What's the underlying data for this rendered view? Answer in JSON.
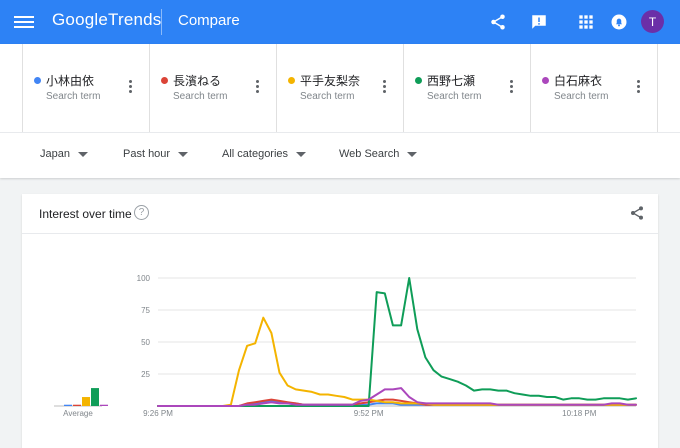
{
  "header": {
    "logo_google": "Google",
    "logo_trends": "Trends",
    "page_title": "Compare",
    "avatar_letter": "T",
    "icons": [
      "menu-icon",
      "share-icon",
      "feedback-icon",
      "apps-icon",
      "notifications-icon"
    ]
  },
  "terms": [
    {
      "name": "小林由依",
      "sub": "Search term",
      "color": "#4285f4"
    },
    {
      "name": "長濱ねる",
      "sub": "Search term",
      "color": "#db4437"
    },
    {
      "name": "平手友梨奈",
      "sub": "Search term",
      "color": "#f4b400"
    },
    {
      "name": "西野七瀬",
      "sub": "Search term",
      "color": "#0f9d58"
    },
    {
      "name": "白石麻衣",
      "sub": "Search term",
      "color": "#ab47bc"
    }
  ],
  "filters": {
    "region": "Japan",
    "time": "Past hour",
    "category": "All categories",
    "property": "Web Search"
  },
  "chart_card": {
    "title": "Interest over time",
    "help": "?"
  },
  "chart_data": {
    "type": "line",
    "y_ticks": [
      "100",
      "75",
      "50",
      "25"
    ],
    "ylim": [
      0,
      100
    ],
    "x_ticks": [
      {
        "label": "9:26 PM",
        "minute": 0
      },
      {
        "label": "9:52 PM",
        "minute": 26
      },
      {
        "label": "10:18 PM",
        "minute": 52
      }
    ],
    "xlim": [
      0,
      59
    ],
    "average_label": "Average",
    "average": [
      1,
      1,
      7,
      14,
      1
    ],
    "grid": true,
    "series": [
      {
        "name": "小林由依",
        "color": "#4285f4",
        "values": [
          0,
          0,
          0,
          0,
          0,
          0,
          0,
          0,
          0,
          0,
          0,
          1,
          2,
          3,
          4,
          3,
          2,
          2,
          1,
          1,
          1,
          1,
          1,
          1,
          1,
          1,
          1,
          2,
          2,
          2,
          1,
          1,
          1,
          1,
          1,
          1,
          1,
          1,
          1,
          1,
          1,
          1,
          1,
          1,
          1,
          1,
          1,
          1,
          1,
          1,
          1,
          1,
          1,
          1,
          1,
          1,
          1,
          1,
          1,
          1
        ]
      },
      {
        "name": "長濱ねる",
        "color": "#db4437",
        "values": [
          0,
          0,
          0,
          0,
          0,
          0,
          0,
          0,
          0,
          0,
          0,
          2,
          3,
          4,
          5,
          4,
          3,
          2,
          1,
          1,
          1,
          1,
          1,
          1,
          1,
          2,
          3,
          4,
          5,
          5,
          4,
          3,
          2,
          1,
          1,
          1,
          1,
          1,
          1,
          1,
          1,
          1,
          1,
          1,
          1,
          1,
          1,
          1,
          1,
          1,
          1,
          1,
          1,
          1,
          1,
          1,
          1,
          1,
          1,
          1
        ]
      },
      {
        "name": "平手友梨奈",
        "color": "#f4b400",
        "values": [
          0,
          0,
          0,
          0,
          0,
          0,
          0,
          0,
          0,
          1,
          28,
          47,
          49,
          69,
          57,
          26,
          16,
          13,
          12,
          11,
          9,
          9,
          8,
          7,
          5,
          5,
          5,
          4,
          3,
          3,
          2,
          2,
          2,
          2,
          1,
          1,
          1,
          1,
          1,
          1,
          1,
          1,
          1,
          1,
          1,
          1,
          1,
          1,
          1,
          1,
          1,
          1,
          1,
          1,
          1,
          1,
          1,
          1,
          1,
          1
        ]
      },
      {
        "name": "西野七瀬",
        "color": "#0f9d58",
        "values": [
          0,
          0,
          0,
          0,
          0,
          0,
          0,
          0,
          0,
          0,
          0,
          0,
          0,
          0,
          0,
          0,
          0,
          0,
          0,
          0,
          0,
          0,
          0,
          0,
          0,
          0,
          0,
          89,
          88,
          63,
          63,
          100,
          60,
          38,
          28,
          23,
          21,
          19,
          16,
          12,
          13,
          13,
          12,
          12,
          10,
          9,
          8,
          8,
          7,
          7,
          5,
          6,
          6,
          5,
          5,
          6,
          6,
          6,
          5,
          6
        ]
      },
      {
        "name": "白石麻衣",
        "color": "#ab47bc",
        "values": [
          0,
          0,
          0,
          0,
          0,
          0,
          0,
          0,
          0,
          0,
          0,
          1,
          1,
          2,
          3,
          2,
          2,
          1,
          1,
          1,
          1,
          1,
          1,
          1,
          1,
          4,
          5,
          9,
          13,
          13,
          14,
          7,
          3,
          2,
          2,
          2,
          2,
          2,
          2,
          2,
          2,
          2,
          1,
          1,
          1,
          1,
          1,
          1,
          1,
          1,
          1,
          1,
          1,
          1,
          1,
          1,
          2,
          2,
          1,
          1
        ]
      }
    ]
  }
}
